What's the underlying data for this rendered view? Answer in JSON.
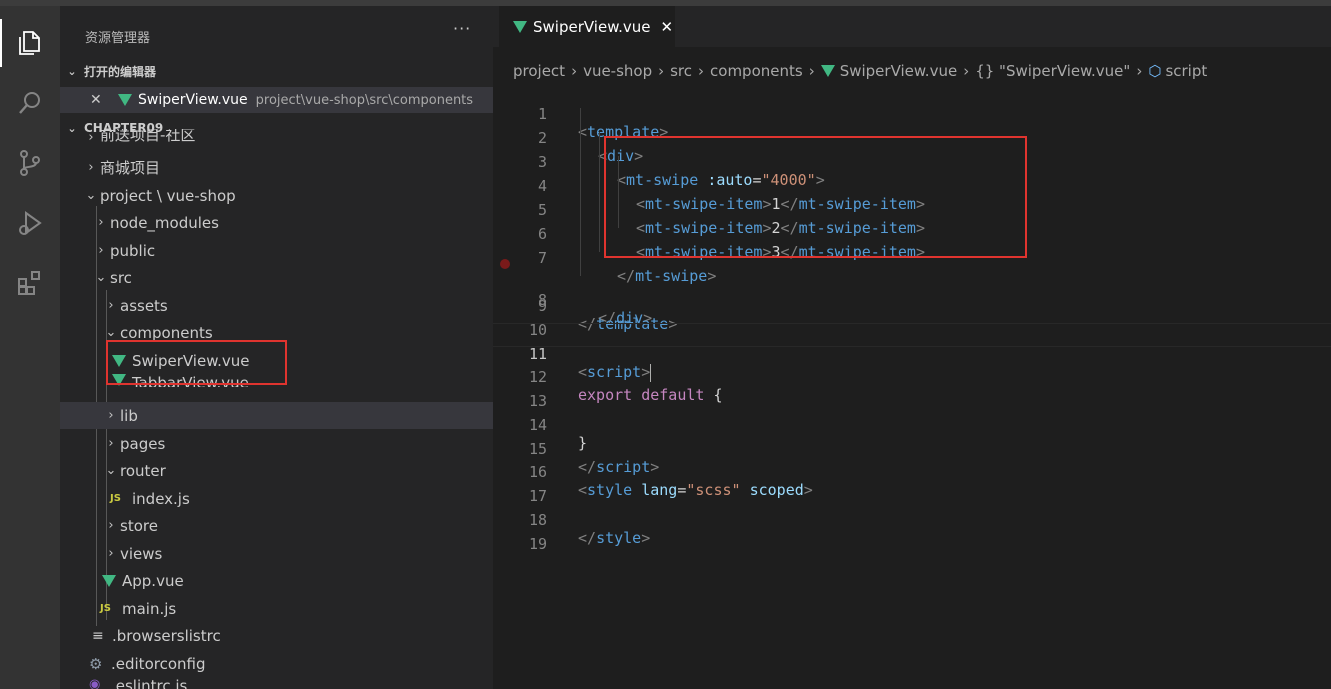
{
  "sidebar": {
    "title": "资源管理器",
    "more": "···",
    "open_editors_header": "打开的编辑器",
    "open_editor": {
      "name": "SwiperView.vue",
      "path": "project\\vue-shop\\src\\components"
    },
    "project_header": "CHAPTER09",
    "tree": [
      {
        "label": "前送项目-社区"
      },
      {
        "label": "商城项目"
      },
      {
        "label": "project \\ vue-shop"
      },
      {
        "label": "node_modules"
      },
      {
        "label": "public"
      },
      {
        "label": "src"
      },
      {
        "label": "assets"
      },
      {
        "label": "components"
      },
      {
        "label": "SwiperView.vue"
      },
      {
        "label": "TabbarView.vue"
      },
      {
        "label": "lib"
      },
      {
        "label": "pages"
      },
      {
        "label": "router"
      },
      {
        "label": "index.js"
      },
      {
        "label": "store"
      },
      {
        "label": "views"
      },
      {
        "label": "App.vue"
      },
      {
        "label": "main.js"
      },
      {
        "label": ".browserslistrc"
      },
      {
        "label": ".editorconfig"
      },
      {
        "label": ".eslintrc.js"
      }
    ]
  },
  "editor": {
    "tab": {
      "label": "SwiperView.vue",
      "close": "✕"
    },
    "breadcrumb": [
      "project",
      "vue-shop",
      "src",
      "components",
      "SwiperView.vue",
      "{} \"SwiperView.vue\"",
      "script"
    ],
    "current_line": 11,
    "lines": [
      {
        "n": "1"
      },
      {
        "n": "2"
      },
      {
        "n": "3"
      },
      {
        "n": "4"
      },
      {
        "n": "5"
      },
      {
        "n": "6"
      },
      {
        "n": "7"
      },
      {
        "n": "8"
      },
      {
        "n": "9"
      },
      {
        "n": "10"
      },
      {
        "n": "11"
      },
      {
        "n": "12"
      },
      {
        "n": "13"
      },
      {
        "n": "14"
      },
      {
        "n": "15"
      },
      {
        "n": "16"
      },
      {
        "n": "17"
      },
      {
        "n": "18"
      },
      {
        "n": "19"
      }
    ],
    "tokens": {
      "l1": [
        "<",
        "template",
        ">"
      ],
      "l2": [
        "<",
        "div",
        ">"
      ],
      "l3": [
        "<",
        "mt-swipe",
        ":auto",
        "=",
        "\"4000\"",
        ">"
      ],
      "l4": [
        "<",
        "mt-swipe-item",
        ">",
        "1",
        "</",
        "mt-swipe-item",
        ">"
      ],
      "l5": [
        "<",
        "mt-swipe-item",
        ">",
        "2",
        "</",
        "mt-swipe-item",
        ">"
      ],
      "l6": [
        "<",
        "mt-swipe-item",
        ">",
        "3",
        "</",
        "mt-swipe-item",
        ">"
      ],
      "l7": [
        "</",
        "mt-swipe",
        ">"
      ],
      "l8": [
        "</",
        "div",
        ">"
      ],
      "l9": [
        "</",
        "template",
        ">"
      ],
      "l11": [
        "<",
        "script",
        ">"
      ],
      "l12": [
        "export",
        "default",
        "{"
      ],
      "l14": [
        "}"
      ],
      "l15": [
        "</",
        "script",
        ">"
      ],
      "l16": [
        "<",
        "style",
        "lang",
        "=",
        "\"scss\"",
        "scoped",
        ">"
      ],
      "l18": [
        "</",
        "style",
        ">"
      ]
    }
  },
  "colors": {
    "accent": "#e0342f",
    "vue": "#41b883",
    "tag": "#569cd6",
    "attr": "#9cdcfe",
    "string": "#ce9178"
  }
}
